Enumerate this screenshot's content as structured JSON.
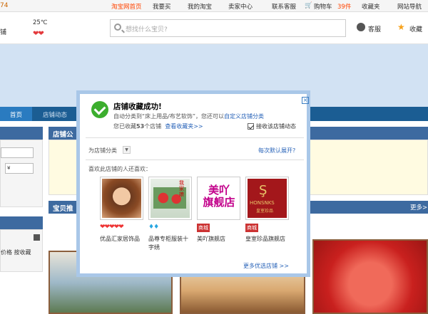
{
  "topbar": {
    "date": "74",
    "items": [
      "淘宝网首页",
      "我要买",
      "我的淘宝",
      "卖家中心",
      "联系客服",
      "购物车",
      "39件",
      "收藏夹",
      "网站导航"
    ]
  },
  "header": {
    "left_text": "铺",
    "temp": "25℃",
    "search_placeholder": "想找什么宝贝?",
    "kefu": "客服",
    "shoucang": "收藏"
  },
  "nav": {
    "home": "首页",
    "dynamic": "店铺动态"
  },
  "sidebar": {
    "sort_label": "价格 按收藏",
    "price_hint": "¥"
  },
  "main": {
    "notice_title": "店铺公",
    "recommend_title": "宝贝推",
    "more": "更多>"
  },
  "modal": {
    "title": "店铺收藏成功!",
    "line1_prefix": "自动分类到“床上用品/布艺软饰”，您还可以",
    "line1_link": "自定义店铺分类",
    "line2_prefix": "您已收藏",
    "line2_count": "53",
    "line2_suffix": "个店铺",
    "line2_link": "查看收藏夹>>",
    "checkbox_label": "接收该店铺动态",
    "category_label": "为店铺分类",
    "expand_link": "每次默认展开?",
    "likes_label": "喜欢此店铺的人还喜欢：",
    "more_shops": "更多优选店铺 >>",
    "shops": [
      {
        "name": "优品汇家居饰品",
        "rating": "❤❤❤❤❤",
        "badge": ""
      },
      {
        "name": "品尊专柜服装十字绣",
        "rating": "♦♦",
        "badge": ""
      },
      {
        "name": "美吖旗舰店",
        "rating": "",
        "badge": "商城",
        "logo_text": "美吖 旗舰店"
      },
      {
        "name": "皇室珍品旗舰店",
        "rating": "",
        "badge": "商城",
        "logo_text": "HONSNKS",
        "logo_sub": "皇室珍品"
      }
    ],
    "shop2_text": "我家娘"
  }
}
